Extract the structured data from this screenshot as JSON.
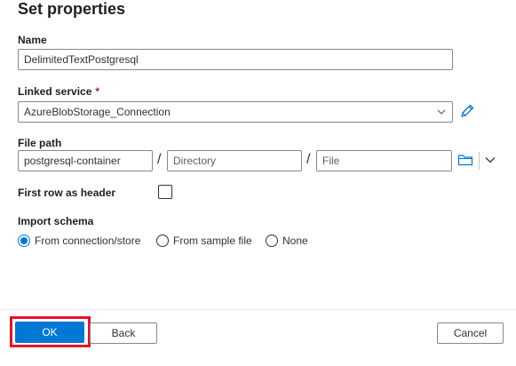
{
  "dialog": {
    "title": "Set properties"
  },
  "name_field": {
    "label": "Name",
    "value": "DelimitedTextPostgresql"
  },
  "linked_service": {
    "label": "Linked service",
    "required_mark": "*",
    "value": "AzureBlobStorage_Connection",
    "icons": {
      "dropdown": "chevron-down-icon",
      "edit": "pencil-icon"
    }
  },
  "file_path": {
    "label": "File path",
    "container_value": "postgresql-container",
    "separator": "/",
    "directory_placeholder": "Directory",
    "file_placeholder": "File",
    "icons": {
      "browse": "folder-icon",
      "more": "chevron-down-icon"
    }
  },
  "first_row_header": {
    "label": "First row as header",
    "checked": false
  },
  "import_schema": {
    "label": "Import schema",
    "options": [
      {
        "label": "From connection/store",
        "selected": true
      },
      {
        "label": "From sample file",
        "selected": false
      },
      {
        "label": "None",
        "selected": false
      }
    ]
  },
  "footer": {
    "ok_label": "OK",
    "back_label": "Back",
    "cancel_label": "Cancel"
  },
  "colors": {
    "accent": "#0078d4",
    "highlight": "#e81123",
    "required": "#a4262c"
  }
}
